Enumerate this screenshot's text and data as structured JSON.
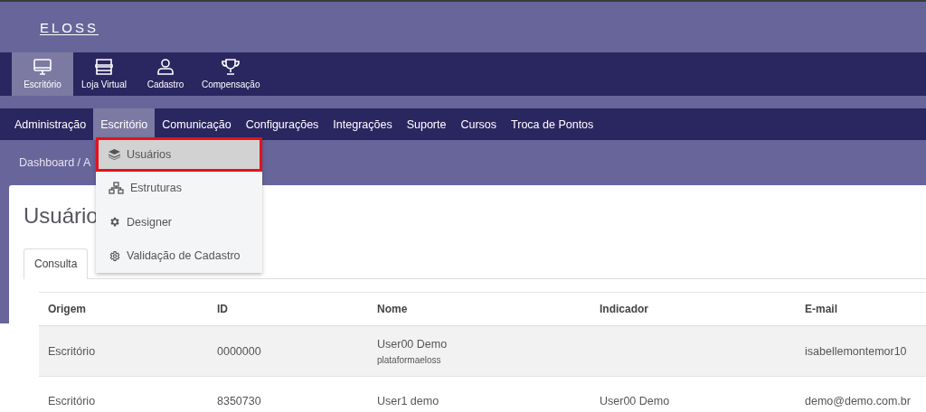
{
  "logo": "ELOSS",
  "app_nav": [
    {
      "label": "Escritório",
      "selected": true
    },
    {
      "label": "Loja Virtual",
      "selected": false
    },
    {
      "label": "Cadastro",
      "selected": false
    },
    {
      "label": "Compensação",
      "selected": false
    }
  ],
  "menu": [
    {
      "label": "Administração",
      "selected": false
    },
    {
      "label": "Escritório",
      "selected": true
    },
    {
      "label": "Comunicação",
      "selected": false
    },
    {
      "label": "Configurações",
      "selected": false
    },
    {
      "label": "Integrações",
      "selected": false
    },
    {
      "label": "Suporte",
      "selected": false
    },
    {
      "label": "Cursos",
      "selected": false
    },
    {
      "label": "Troca de Pontos",
      "selected": false
    }
  ],
  "dropdown": [
    {
      "label": "Usuários",
      "selected": true
    },
    {
      "label": "Estruturas",
      "selected": false
    },
    {
      "label": "Designer",
      "selected": false
    },
    {
      "label": "Validação de Cadastro",
      "selected": false
    }
  ],
  "breadcrumb": "Dashboard / A",
  "page_title": "Usuário",
  "tabs": [
    {
      "label": "Consulta"
    }
  ],
  "table": {
    "columns": [
      "Origem",
      "ID",
      "Nome",
      "Indicador",
      "E-mail"
    ],
    "rows": [
      {
        "origem": "Escritório",
        "id": "0000000",
        "nome": "User00 Demo",
        "login": "plataformaeloss",
        "indicador": "",
        "email": "isabellemontemor10"
      },
      {
        "origem": "Escritório",
        "id": "8350730",
        "nome": "User1 demo",
        "login": "",
        "indicador": "User00 Demo",
        "email": "demo@demo.com.br"
      }
    ]
  }
}
